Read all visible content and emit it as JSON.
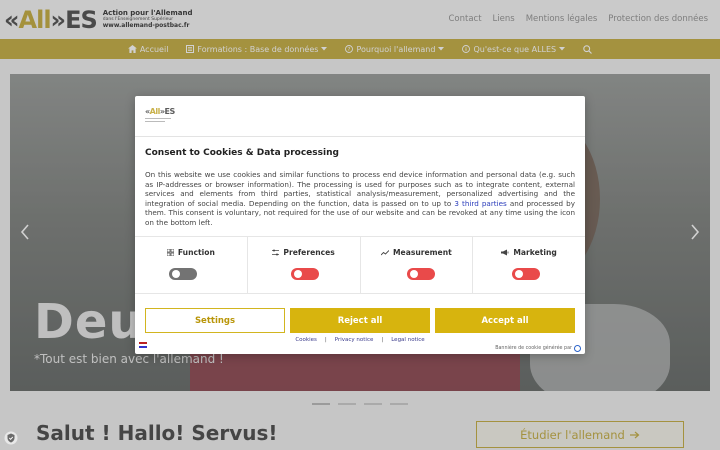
{
  "header": {
    "logo_text": "ALLES",
    "logo_line1": "Action pour l'Allemand",
    "logo_line2": "dans l'Enseignement Supérieur",
    "logo_line3": "www.allemand-postbac.fr",
    "top_links": [
      "Contact",
      "Liens",
      "Mentions légales",
      "Protection des données"
    ]
  },
  "nav": {
    "items": [
      {
        "label": "Accueil",
        "icon": "home-icon"
      },
      {
        "label": "Formations : Base de données",
        "icon": "list-icon",
        "dropdown": true
      },
      {
        "label": "Pourquoi l'allemand",
        "icon": "question-icon",
        "dropdown": true
      },
      {
        "label": "Qu'est-ce que ALLES",
        "icon": "info-icon",
        "dropdown": true
      }
    ],
    "search_icon": "search-icon"
  },
  "hero": {
    "title": "Deut",
    "subtitle": "*Tout est bien avec l'allemand !"
  },
  "carousel": {
    "active_index": 0,
    "count": 4
  },
  "main": {
    "heading": "Salut ! Hallo! Servus!",
    "cta": "Étudier l'allemand"
  },
  "consent": {
    "title": "Consent to Cookies & Data processing",
    "body_part1": "On this website we use cookies and similar functions to process end device information and personal data (e.g. such as IP-addresses or browser information). The processing is used for purposes such as to integrate content, external services and elements from third parties, statistical analysis/measurement, personalized advertising and the integration of social media. Depending on the function, data is passed on to up to ",
    "body_link": "3 third parties",
    "body_part2": " and processed by them. This consent is voluntary, not required for the use of our website and can be revoked at any time using the icon on the bottom left.",
    "categories": [
      {
        "label": "Function",
        "icon": "grid-icon",
        "enabled": true,
        "locked": true
      },
      {
        "label": "Preferences",
        "icon": "sliders-icon",
        "enabled": false
      },
      {
        "label": "Measurement",
        "icon": "chart-line-icon",
        "enabled": false
      },
      {
        "label": "Marketing",
        "icon": "megaphone-icon",
        "enabled": false
      }
    ],
    "buttons": {
      "settings": "Settings",
      "reject": "Reject all",
      "accept": "Accept all"
    },
    "footer_links": [
      "Cookies",
      "Privacy notice",
      "Legal notice"
    ],
    "separator": "|",
    "banner_note": "Bannière de cookie générée par"
  },
  "colors": {
    "brand_gold": "#c8b24e",
    "button_gold": "#d7b40e",
    "toggle_off": "#e94a4a",
    "toggle_locked": "#737373"
  }
}
